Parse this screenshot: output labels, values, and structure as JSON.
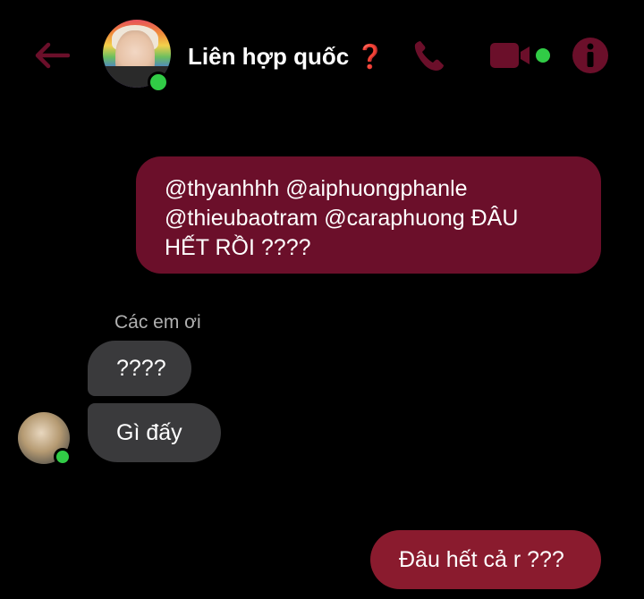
{
  "header": {
    "back_icon": "arrow-left-icon",
    "title": "Liên hợp quốc",
    "title_emoji": "❓",
    "call_icon": "phone-icon",
    "video_icon": "video-camera-icon",
    "info_icon": "info-icon"
  },
  "colors": {
    "accent": "#6b0f2a",
    "outgoing_bubble": "#6b0f2a",
    "outgoing_bubble_last": "#8a1b2e",
    "incoming_bubble": "#3a3a3c",
    "online": "#31cc46",
    "background": "#000000"
  },
  "messages": {
    "outgoing_1": {
      "line1": "@thyanhhh @aiphuongphanle",
      "line2": "@thieubaotram @caraphuong ĐÂU",
      "line3": "HẾT RỒI ????"
    },
    "group_sender": "Các em ơi",
    "incoming_1": "????",
    "incoming_2": "Gì đấy",
    "outgoing_2": "Đâu hết cả r ???"
  }
}
